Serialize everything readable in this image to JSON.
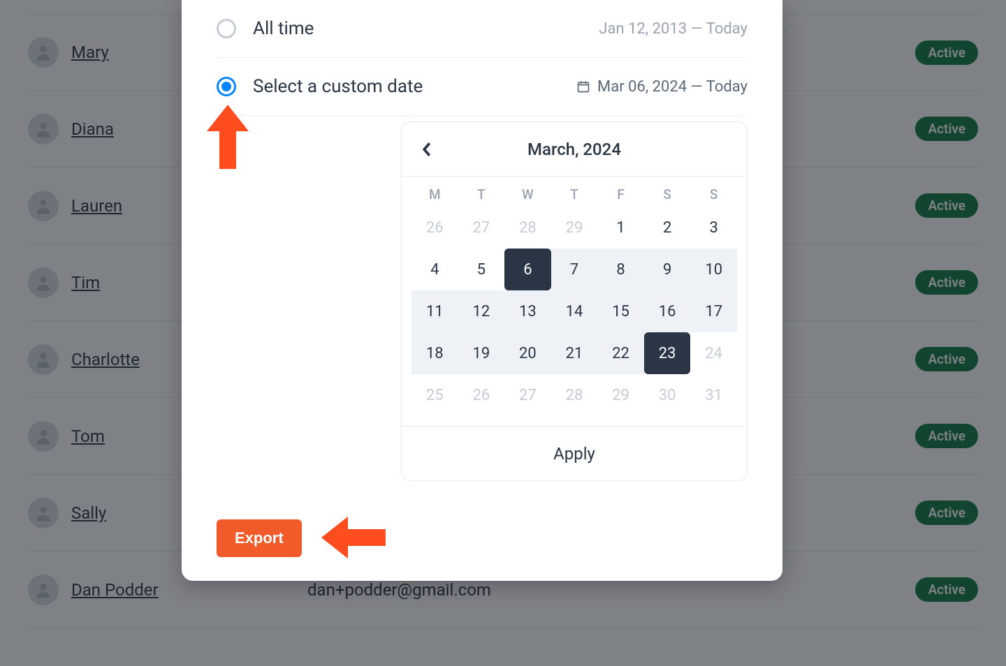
{
  "list": {
    "rows": [
      {
        "name": "Mary",
        "status": "Active"
      },
      {
        "name": "Diana",
        "status": "Active"
      },
      {
        "name": "Lauren",
        "status": "Active"
      },
      {
        "name": "Tim",
        "status": "Active"
      },
      {
        "name": "Charlotte",
        "status": "Active"
      },
      {
        "name": "Tom",
        "status": "Active"
      },
      {
        "name": "Sally",
        "status": "Active"
      },
      {
        "name": "Dan Podder",
        "email": "dan+podder@gmail.com",
        "status": "Active"
      }
    ]
  },
  "modal": {
    "options": {
      "all_time": {
        "label": "All time",
        "range": "Jan 12, 2013 — Today"
      },
      "custom": {
        "label": "Select a custom date",
        "range": "Mar 06, 2024 — Today"
      }
    },
    "calendar": {
      "title": "March, 2024",
      "dow": [
        "M",
        "T",
        "W",
        "T",
        "F",
        "S",
        "S"
      ],
      "weeks": [
        [
          {
            "d": "26",
            "out": true
          },
          {
            "d": "27",
            "out": true
          },
          {
            "d": "28",
            "out": true
          },
          {
            "d": "29",
            "out": true
          },
          {
            "d": "1"
          },
          {
            "d": "2"
          },
          {
            "d": "3"
          }
        ],
        [
          {
            "d": "4"
          },
          {
            "d": "5"
          },
          {
            "d": "6",
            "sel": true
          },
          {
            "d": "7",
            "range": true
          },
          {
            "d": "8",
            "range": true
          },
          {
            "d": "9",
            "range": true
          },
          {
            "d": "10",
            "range": true
          }
        ],
        [
          {
            "d": "11",
            "range": true
          },
          {
            "d": "12",
            "range": true
          },
          {
            "d": "13",
            "range": true
          },
          {
            "d": "14",
            "range": true
          },
          {
            "d": "15",
            "range": true
          },
          {
            "d": "16",
            "range": true
          },
          {
            "d": "17",
            "range": true
          }
        ],
        [
          {
            "d": "18",
            "range": true
          },
          {
            "d": "19",
            "range": true
          },
          {
            "d": "20",
            "range": true
          },
          {
            "d": "21",
            "range": true
          },
          {
            "d": "22",
            "range": true
          },
          {
            "d": "23",
            "sel": true
          },
          {
            "d": "24",
            "out": true
          }
        ],
        [
          {
            "d": "25",
            "out": true
          },
          {
            "d": "26",
            "out": true
          },
          {
            "d": "27",
            "out": true
          },
          {
            "d": "28",
            "out": true
          },
          {
            "d": "29",
            "out": true
          },
          {
            "d": "30",
            "out": true
          },
          {
            "d": "31",
            "out": true
          }
        ]
      ],
      "apply_label": "Apply"
    },
    "export_label": "Export"
  }
}
